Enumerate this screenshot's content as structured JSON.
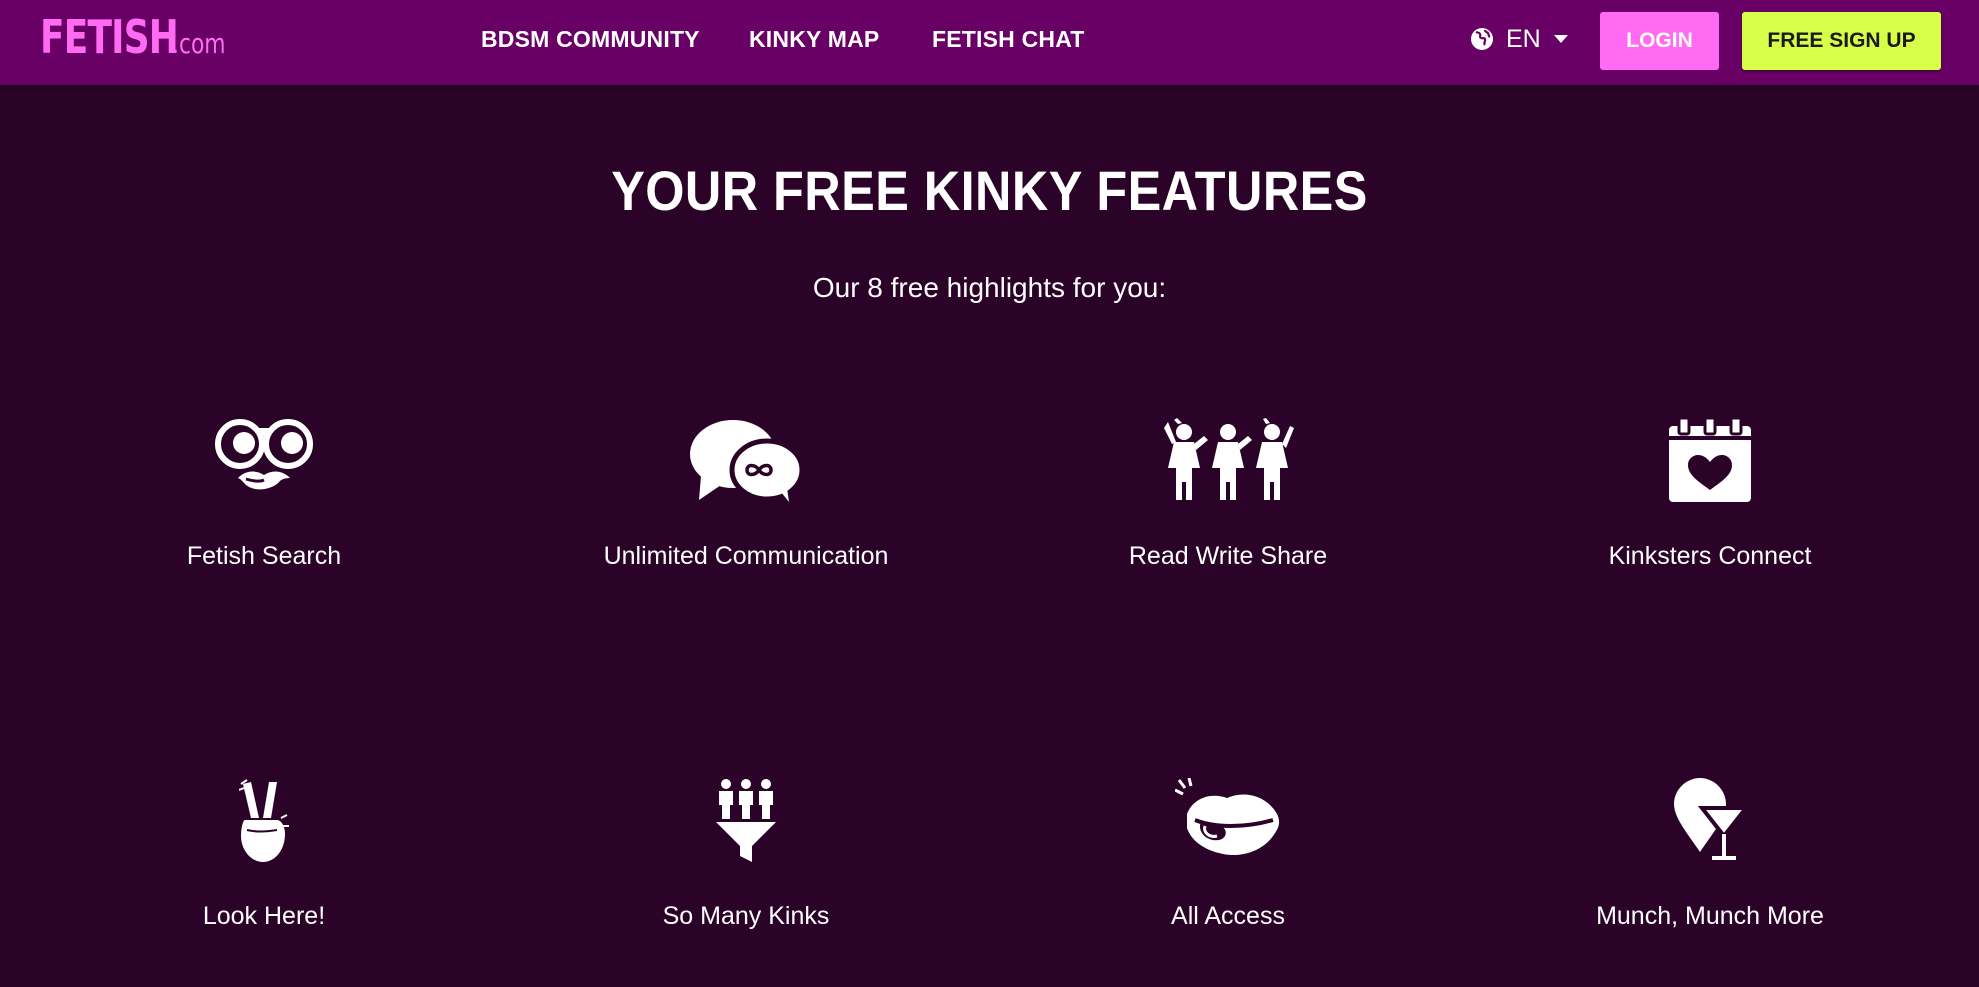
{
  "header": {
    "logo_main": "FETISH",
    "logo_sub": ".com",
    "nav": [
      {
        "label": "BDSM COMMUNITY"
      },
      {
        "label": "KINKY MAP"
      },
      {
        "label": "FETISH CHAT"
      }
    ],
    "language": "EN",
    "login_label": "LOGIN",
    "signup_label": "FREE SIGN UP"
  },
  "main": {
    "title": "YOUR FREE KINKY FEATURES",
    "subtitle": "Our 8 free highlights for you:",
    "features": [
      {
        "label": "Fetish Search",
        "icon": "binoculars-lips-icon"
      },
      {
        "label": "Unlimited Communication",
        "icon": "chat-bubbles-infinity-icon"
      },
      {
        "label": "Read Write Share",
        "icon": "three-people-icon"
      },
      {
        "label": "Kinksters Connect",
        "icon": "calendar-heart-icon"
      },
      {
        "label": "Look Here!",
        "icon": "peace-hand-icon"
      },
      {
        "label": "So Many Kinks",
        "icon": "people-funnel-icon"
      },
      {
        "label": "All Access",
        "icon": "licking-lips-icon"
      },
      {
        "label": "Munch, Munch More",
        "icon": "location-cocktail-icon"
      }
    ]
  },
  "colors": {
    "background": "#2c0328",
    "header": "#690066",
    "accent_pink": "#ff6cf3",
    "accent_green": "#d7ff47"
  }
}
